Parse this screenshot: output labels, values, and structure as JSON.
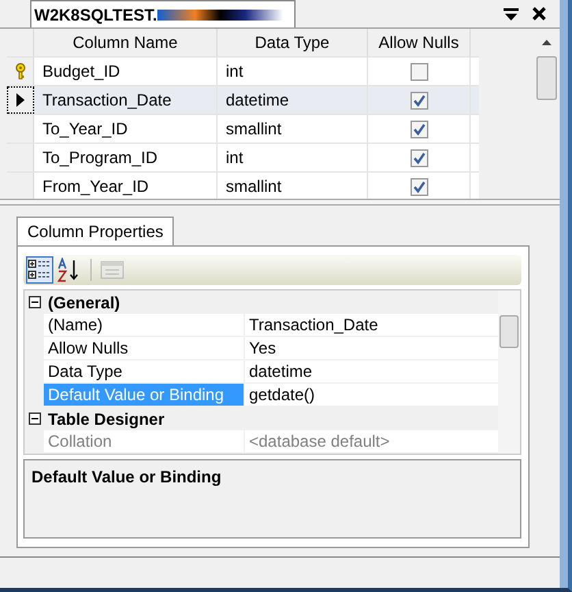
{
  "document_tab": {
    "title": "W2K8SQLTEST.",
    "redacted": true
  },
  "table": {
    "columns": [
      "Column Name",
      "Data Type",
      "Allow Nulls"
    ],
    "rows": [
      {
        "column_name": "Budget_ID",
        "data_type": "int",
        "allow_nulls": false,
        "primary_key": true,
        "selected": false
      },
      {
        "column_name": "Transaction_Date",
        "data_type": "datetime",
        "allow_nulls": true,
        "primary_key": false,
        "selected": true
      },
      {
        "column_name": "To_Year_ID",
        "data_type": "smallint",
        "allow_nulls": true,
        "primary_key": false,
        "selected": false
      },
      {
        "column_name": "To_Program_ID",
        "data_type": "int",
        "allow_nulls": true,
        "primary_key": false,
        "selected": false
      },
      {
        "column_name": "From_Year_ID",
        "data_type": "smallint",
        "allow_nulls": true,
        "primary_key": false,
        "selected": false
      }
    ]
  },
  "properties_tab": {
    "label": "Column Properties"
  },
  "toolbar": [
    {
      "kind": "categorized",
      "selected": true,
      "disabled": false
    },
    {
      "kind": "alphabetical",
      "selected": false,
      "disabled": false
    },
    {
      "kind": "pages",
      "selected": false,
      "disabled": true
    }
  ],
  "property_grid": [
    {
      "category": "(General)",
      "expanded": true,
      "items": [
        {
          "name": "(Name)",
          "value": "Transaction_Date",
          "selected": false,
          "disabled": false
        },
        {
          "name": "Allow Nulls",
          "value": "Yes",
          "selected": false,
          "disabled": false
        },
        {
          "name": "Data Type",
          "value": "datetime",
          "selected": false,
          "disabled": false
        },
        {
          "name": "Default Value or Binding",
          "value": "getdate()",
          "selected": true,
          "disabled": false
        }
      ]
    },
    {
      "category": "Table Designer",
      "expanded": true,
      "items": [
        {
          "name": "Collation",
          "value": "<database default>",
          "selected": false,
          "disabled": true
        }
      ]
    }
  ],
  "description": {
    "title": "Default Value or Binding"
  }
}
